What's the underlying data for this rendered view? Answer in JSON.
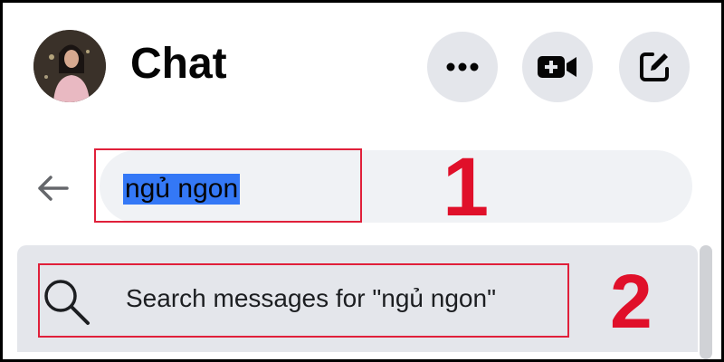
{
  "header": {
    "title": "Chat",
    "avatar": "user-avatar-photo",
    "buttons": [
      {
        "name": "more-options-button",
        "icon": "ellipsis-icon"
      },
      {
        "name": "new-room-button",
        "icon": "video-plus-icon"
      },
      {
        "name": "new-message-button",
        "icon": "compose-icon"
      }
    ]
  },
  "search": {
    "back_icon": "arrow-left-icon",
    "query": "ngủ ngon",
    "annotation": "1"
  },
  "results": {
    "items": [
      {
        "label": "Search messages for \"ngủ ngon\"",
        "icon": "search-icon"
      }
    ],
    "annotation": "2"
  },
  "colors": {
    "accent": "#3478f6",
    "annotation": "#e0203a",
    "button_bg": "#e4e6eb",
    "search_bg": "#f0f2f5"
  }
}
